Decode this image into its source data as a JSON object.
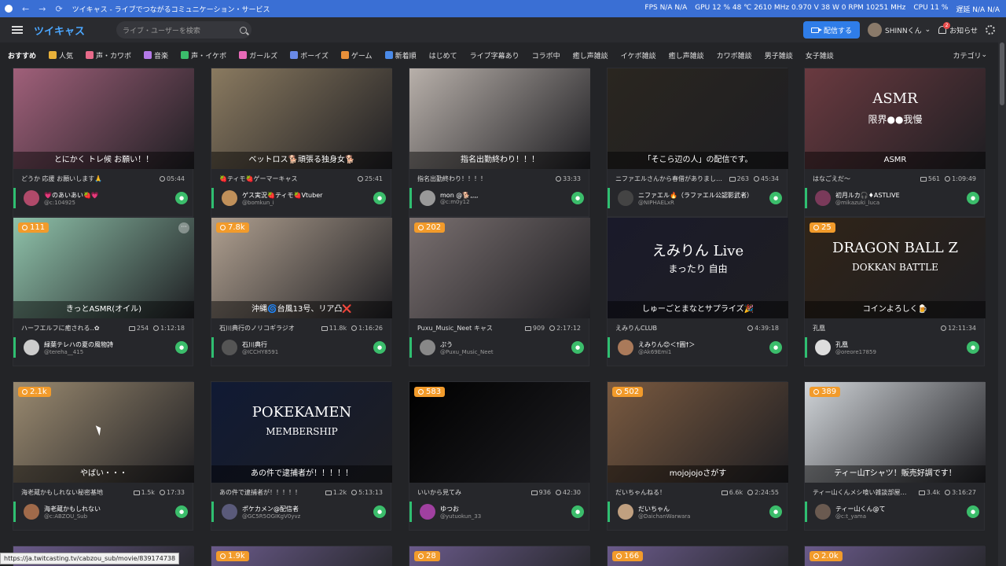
{
  "os_bar": {
    "title": "ツイキャス - ライブでつながるコミュニケーション・サービス",
    "perf": [
      "FPS N/A N/A",
      "GPU 12 % 48 ℃ 2610 MHz 0.970 V 38 W 0 RPM 10251 MHz",
      "CPU 11 %",
      "遅延 N/A N/A"
    ]
  },
  "header": {
    "brand": "ツイキャス",
    "search_placeholder": "ライブ・ユーザーを検索",
    "stream_button": "配信する",
    "username": "SHINNくん",
    "notification_count": "2",
    "notifications_label": "お知らせ"
  },
  "categories": [
    {
      "label": "おすすめ",
      "icon_color": ""
    },
    {
      "label": "人気",
      "icon_color": "#e8b13a"
    },
    {
      "label": "声・カワボ",
      "icon_color": "#e86a8a"
    },
    {
      "label": "音楽",
      "icon_color": "#b47ae8"
    },
    {
      "label": "声・イケボ",
      "icon_color": "#3bbd6b"
    },
    {
      "label": "ガールズ",
      "icon_color": "#e86ab8"
    },
    {
      "label": "ボーイズ",
      "icon_color": "#6a8ae8"
    },
    {
      "label": "ゲーム",
      "icon_color": "#e8903a"
    },
    {
      "label": "新着順",
      "icon_color": "#4a8ae8"
    },
    {
      "label": "はじめて",
      "icon_color": ""
    },
    {
      "label": "ライブ字幕あり",
      "icon_color": ""
    },
    {
      "label": "コラボ中",
      "icon_color": ""
    },
    {
      "label": "癒し声雑談",
      "icon_color": ""
    },
    {
      "label": "イケボ雑談",
      "icon_color": ""
    },
    {
      "label": "癒し声雑談",
      "icon_color": ""
    },
    {
      "label": "カワボ雑談",
      "icon_color": ""
    },
    {
      "label": "男子雑談",
      "icon_color": ""
    },
    {
      "label": "女子雑談",
      "icon_color": ""
    }
  ],
  "categories_more": "カテゴリ",
  "streams": [
    {
      "caption": "とにかく トレ候 お願い！！",
      "viewers": "",
      "desc": "どうか 応援 お願いします🙏",
      "comments": "",
      "time": "05:44",
      "owner": "💗のあいあい🍓💗",
      "id": "@c:104925",
      "bg": "#a0607a",
      "av": "#b04a6a"
    },
    {
      "caption": "ベットロス🐕頑張る独身女🐕",
      "viewers": "",
      "desc": "🍓ティモ🍓ゲーマーキャス",
      "comments": "",
      "time": "25:41",
      "owner": "ゲス実況🍓ティモ🍓Vtuber",
      "id": "@bomkun_i",
      "bg": "#8a7a60",
      "av": "#c0905a"
    },
    {
      "caption": "指名出勤終わり！！！",
      "viewers": "",
      "desc": "指名出勤終わり！！！！",
      "comments": "",
      "time": "33:33",
      "owner": "mon @🐕,,,,",
      "id": "@c:m0y12",
      "bg": "#b8b0aa",
      "av": "#999"
    },
    {
      "caption": "「そこら辺の人」の配信です。",
      "viewers": "",
      "desc": "ニファエルさんから春借がありまし…",
      "comments": "263",
      "time": "45:34",
      "owner": "ニファエル🔥（ラファエル公認影武者）",
      "id": "@NIPHAELxR",
      "bg": "#2a2620",
      "av": "#444"
    },
    {
      "caption": "ASMR",
      "viewers": "",
      "desc": "はなごえだ〜",
      "comments": "561",
      "time": "1:09:49",
      "owner": "初月ルカ🎧♦ASTLIVE",
      "id": "@mikazuki_luca",
      "bg": "#6a3a40",
      "av": "#7a3a5a"
    },
    {
      "caption": "きっとASMR(オイル)",
      "viewers": "111",
      "desc": "ハーフエルフに癒される‥✿",
      "comments": "254",
      "time": "1:12:18",
      "owner": "緑葉テレハの夏の風物詩",
      "id": "@tereha__415",
      "bg": "#8fc2aa",
      "av": "#ccc"
    },
    {
      "caption": "沖縄🌀台風13号、リア凸❌",
      "viewers": "7.8k",
      "desc": "石川典行のノリコギラジオ",
      "comments": "11.8k",
      "time": "1:16:26",
      "owner": "石川典行",
      "id": "@ICCHY8591",
      "bg": "#b0a090",
      "av": "#555"
    },
    {
      "caption": "",
      "viewers": "202",
      "desc": "Puxu_Music_Neet キャス",
      "comments": "909",
      "time": "2:17:12",
      "owner": "ぷう",
      "id": "@Puxu_Music_Neet",
      "bg": "#7a7070",
      "av": "#888"
    },
    {
      "caption": "しゅーごとまなとサプライズ🎉",
      "viewers": "",
      "desc": "えみりんCLUB",
      "comments": "",
      "time": "4:39:18",
      "owner": "えみりん😊＜†圓†＞",
      "id": "@Ak69Emi1",
      "bg": "#1a1a2a",
      "av": "#aa7a5a"
    },
    {
      "caption": "コインよろしく🍺",
      "viewers": "25",
      "desc": "孔凰",
      "comments": "",
      "time": "12:11:34",
      "owner": "孔凰",
      "id": "@oreore17859",
      "bg": "#302418",
      "av": "#ddd"
    },
    {
      "caption": "やばい・・・",
      "viewers": "2.1k",
      "desc": "海老蔵かもしれない秘密基地",
      "comments": "1.5k",
      "time": "17:33",
      "owner": "海老蔵かもしれない",
      "id": "@c:ABZOU_Sub",
      "bg": "#9a8a70",
      "av": "#a06a4a"
    },
    {
      "caption": "あの件で逮捕者が！！！！！",
      "viewers": "",
      "desc": "あの件で逮捕者が！！！！！",
      "comments": "1.2k",
      "time": "5:13:13",
      "owner": "ポケカメン@配信者",
      "id": "@GC5R5OGIKgV0yvz",
      "bg": "#101a34",
      "av": "#5a5a7a"
    },
    {
      "caption": "",
      "viewers": "583",
      "desc": "いいから見てみ",
      "comments": "936",
      "time": "42:30",
      "owner": "ゆつお",
      "id": "@yutuokun_33",
      "bg": "#000000",
      "av": "#a040a0"
    },
    {
      "caption": "mojojojoさがす",
      "viewers": "502",
      "desc": "だいちゃんねる！",
      "comments": "6.6k",
      "time": "2:24:55",
      "owner": "だいちゃん",
      "id": "@DaichanWarwara",
      "bg": "#7a5a40",
      "av": "#c0a080"
    },
    {
      "caption": "ティー山Tシャツ！販売好調です！",
      "viewers": "389",
      "desc": "ティー山くんメシ喰い雑談部屋…",
      "comments": "3.4k",
      "time": "3:16:27",
      "owner": "ティー山くん@て",
      "id": "@c:t_yama",
      "bg": "#d0d4d8",
      "av": "#6a5a50"
    }
  ],
  "bottom_viewers": [
    "",
    "1.9k",
    "28",
    "166",
    "2.0k"
  ],
  "thumb_text": {
    "poke_title": "POKEKAMEN",
    "poke_sub": "MEMBERSHIP",
    "asmr": "ASMR",
    "asmr_sub": "限界●●我慢",
    "emirin": "えみりん Live",
    "emirin_sub": "まったり 自由",
    "dokkan": "DRAGON BALL Z",
    "dokkan_sub": "DOKKAN BATTLE"
  },
  "status_url": "https://ja.twitcasting.tv/cabzou_sub/movie/839174738"
}
